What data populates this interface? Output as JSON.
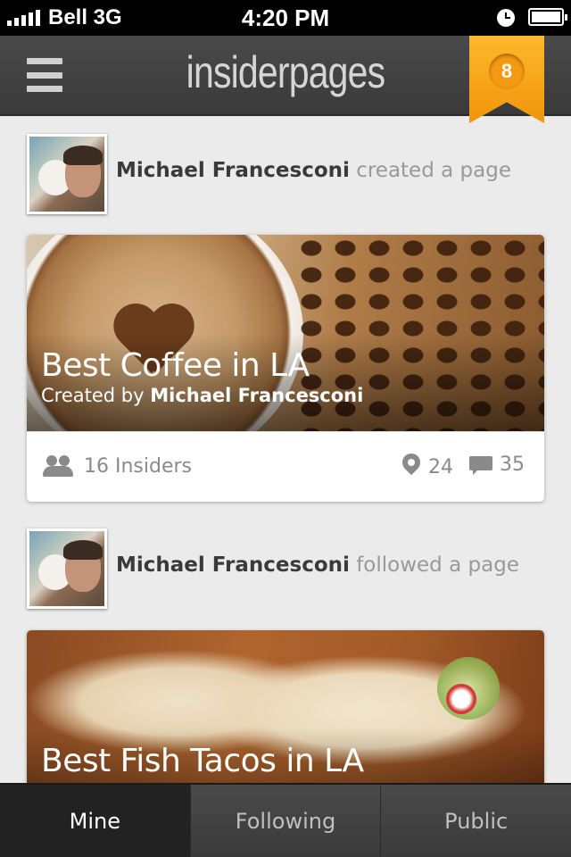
{
  "status_bar": {
    "carrier": "Bell 3G",
    "time": "4:20 PM",
    "icons": [
      "signal-icon",
      "clock-icon",
      "battery-icon"
    ]
  },
  "nav": {
    "logo": "insiderpages",
    "notification_count": "8",
    "menu_icon": "menu-icon",
    "accent_color": "#f7a21b"
  },
  "feed": [
    {
      "user": "Michael Francesconi",
      "action": "created a page",
      "card": {
        "title": "Best Coffee in LA",
        "subtitle_prefix": "Created by ",
        "creator": "Michael Francesconi",
        "insiders": "16 Insiders",
        "places": "24",
        "comments": "35"
      }
    },
    {
      "user": "Michael Francesconi",
      "action": "followed a page",
      "card": {
        "title": "Best Fish Tacos in LA"
      }
    }
  ],
  "tabs": [
    {
      "label": "Mine",
      "active": true
    },
    {
      "label": "Following",
      "active": false
    },
    {
      "label": "Public",
      "active": false
    }
  ]
}
